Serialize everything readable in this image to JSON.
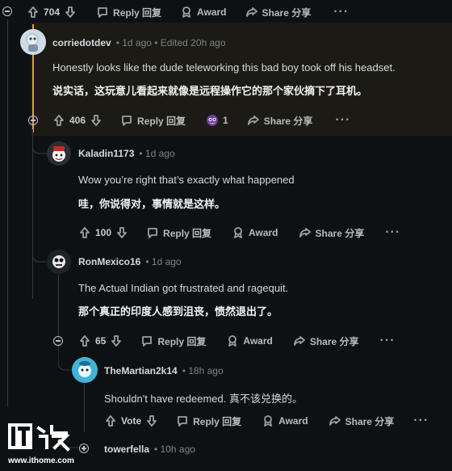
{
  "labels": {
    "reply": "Reply 回复",
    "award": "Award",
    "share": "Share 分享",
    "vote": "Vote",
    "more": "···"
  },
  "top_row": {
    "votes": "704"
  },
  "comments": [
    {
      "user": "corriedotdev",
      "meta": "• 1d ago • Edited 20h ago",
      "text_en": "Honestly looks like the dude teleworking this bad boy took off his headset.",
      "text_cn": "说实话，这玩意儿看起来就像是远程操作它的那个家伙摘下了耳机。",
      "votes": "406",
      "award_count": "1"
    },
    {
      "user": "Kaladin1173",
      "meta": "• 1d ago",
      "text_en": "Wow you’re right that’s exactly what happened",
      "text_cn": "哇，你说得对，事情就是这样。",
      "votes": "100"
    },
    {
      "user": "RonMexico16",
      "meta": "• 1d ago",
      "text_en": "The Actual Indian got frustrated and ragequit.",
      "text_cn": "那个真正的印度人感到沮丧，愤然退出了。",
      "votes": "65"
    },
    {
      "user": "TheMartian2k14",
      "meta": "• 18h ago",
      "text": "Shouldn't have redeemed. 真不该兑换的。"
    },
    {
      "user": "towerfella",
      "meta": "• 10h ago"
    }
  ],
  "watermark": {
    "logo": "IT之家",
    "url": "www.ithome.com"
  },
  "colors": {
    "background": "#0e1113",
    "highlight_bar": "#e0a32c",
    "highlight_bg": "#1b1a14"
  }
}
